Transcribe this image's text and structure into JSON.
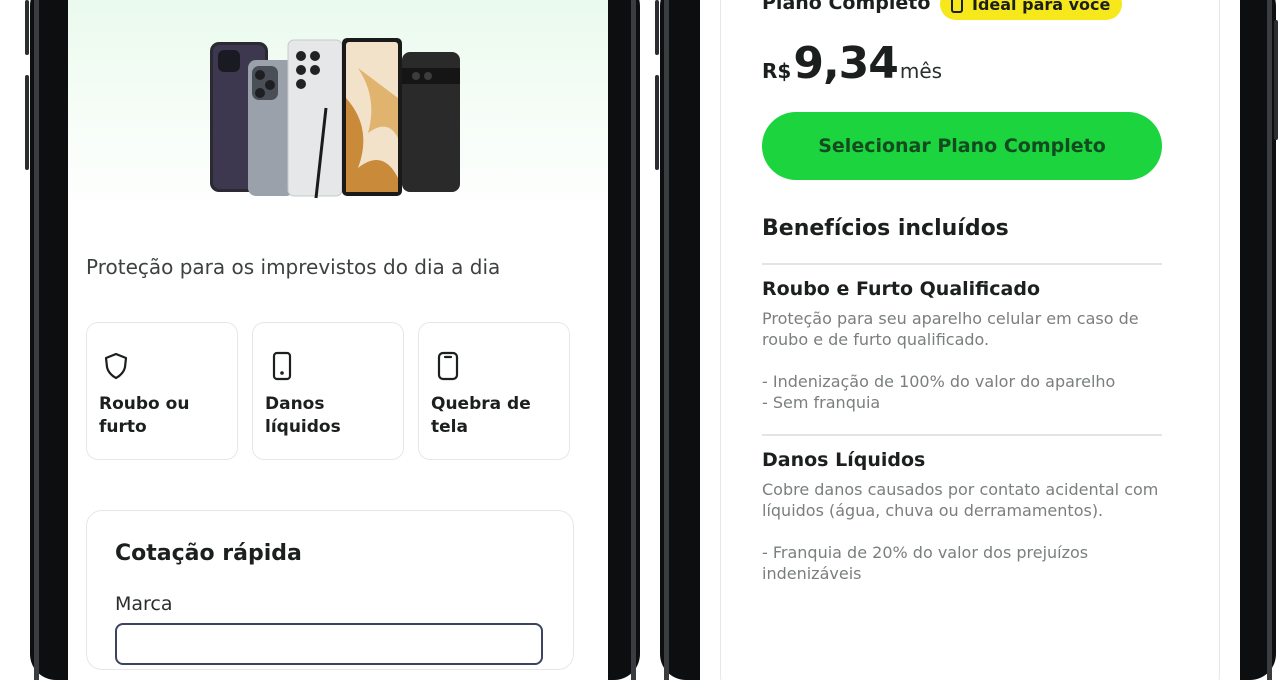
{
  "left_screen": {
    "tagline": "Proteção para os imprevistos do dia a dia",
    "features": [
      {
        "icon": "shield-icon",
        "label": "Roubo ou furto"
      },
      {
        "icon": "phone-icon",
        "label": "Danos líquidos"
      },
      {
        "icon": "phone-icon",
        "label": "Quebra de tela"
      }
    ],
    "quote": {
      "title": "Cotação rápida",
      "brand_label": "Marca"
    }
  },
  "right_screen": {
    "plan_name": "Plano Completo",
    "badge": "Ideal para você",
    "price": {
      "currency": "R$",
      "value": "9,34",
      "period": "mês"
    },
    "select_button": "Selecionar Plano Completo",
    "benefits_title": "Benefícios incluídos",
    "benefits": [
      {
        "title": "Roubo e Furto Qualificado",
        "description": "Proteção para seu aparelho celular em caso de roubo e de furto qualificado.\n\n- Indenização de 100% do valor do aparelho\n- Sem franquia"
      },
      {
        "title": "Danos Líquidos",
        "description": "Cobre danos causados por contato acidental com líquidos (água, chuva ou derramamentos).\n\n- Franquia de 20% do valor dos prejuízos indenizáveis"
      }
    ]
  },
  "colors": {
    "accent_green": "#1bd43e",
    "badge_yellow": "#f6e81a",
    "frame": "#0d0e0f"
  }
}
